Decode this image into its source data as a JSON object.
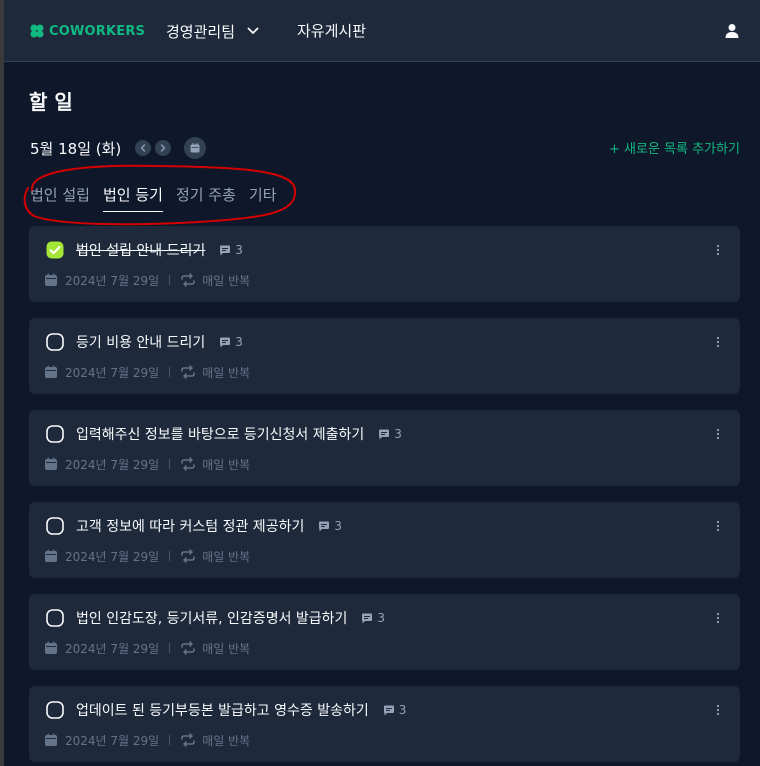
{
  "header": {
    "logo_text": "COWORKERS",
    "team_name": "경영관리팀",
    "board_link": "자유게시판"
  },
  "page": {
    "title": "할 일",
    "date": "5월 18일 (화)",
    "add_list": "+ 새로운 목록 추가하기"
  },
  "tabs": [
    {
      "label": "법인 설립",
      "active": false
    },
    {
      "label": "법인 등기",
      "active": true
    },
    {
      "label": "정기 주총",
      "active": false
    },
    {
      "label": "기타",
      "active": false
    }
  ],
  "tasks": [
    {
      "title": "법인 설립 안내 드리기",
      "done": true,
      "comments": "3",
      "date": "2024년 7월 29일",
      "repeat": "매일 반복"
    },
    {
      "title": "등기 비용 안내 드리기",
      "done": false,
      "comments": "3",
      "date": "2024년 7월 29일",
      "repeat": "매일 반복"
    },
    {
      "title": "입력해주신 정보를 바탕으로 등기신청서 제출하기",
      "done": false,
      "comments": "3",
      "date": "2024년 7월 29일",
      "repeat": "매일 반복"
    },
    {
      "title": "고객 정보에 따라 커스텀 정관 제공하기",
      "done": false,
      "comments": "3",
      "date": "2024년 7월 29일",
      "repeat": "매일 반복"
    },
    {
      "title": "법인 인감도장, 등기서류, 인감증명서 발급하기",
      "done": false,
      "comments": "3",
      "date": "2024년 7월 29일",
      "repeat": "매일 반복"
    },
    {
      "title": "업데이트 된 등기부등본 발급하고 영수증 발송하기",
      "done": false,
      "comments": "3",
      "date": "2024년 7월 29일",
      "repeat": "매일 반복"
    }
  ],
  "colors": {
    "background": "#0f172a",
    "surface": "#1e293b",
    "accent": "#10b981",
    "check_done": "#a3e635",
    "annotation": "#d40000"
  },
  "icons": [
    "logo-icon",
    "chevron-down-icon",
    "user-icon",
    "chevron-left-icon",
    "chevron-right-icon",
    "calendar-icon",
    "checkbox-checked-icon",
    "checkbox-icon",
    "comment-icon",
    "kebab-menu-icon",
    "calendar-small-icon",
    "repeat-icon"
  ]
}
